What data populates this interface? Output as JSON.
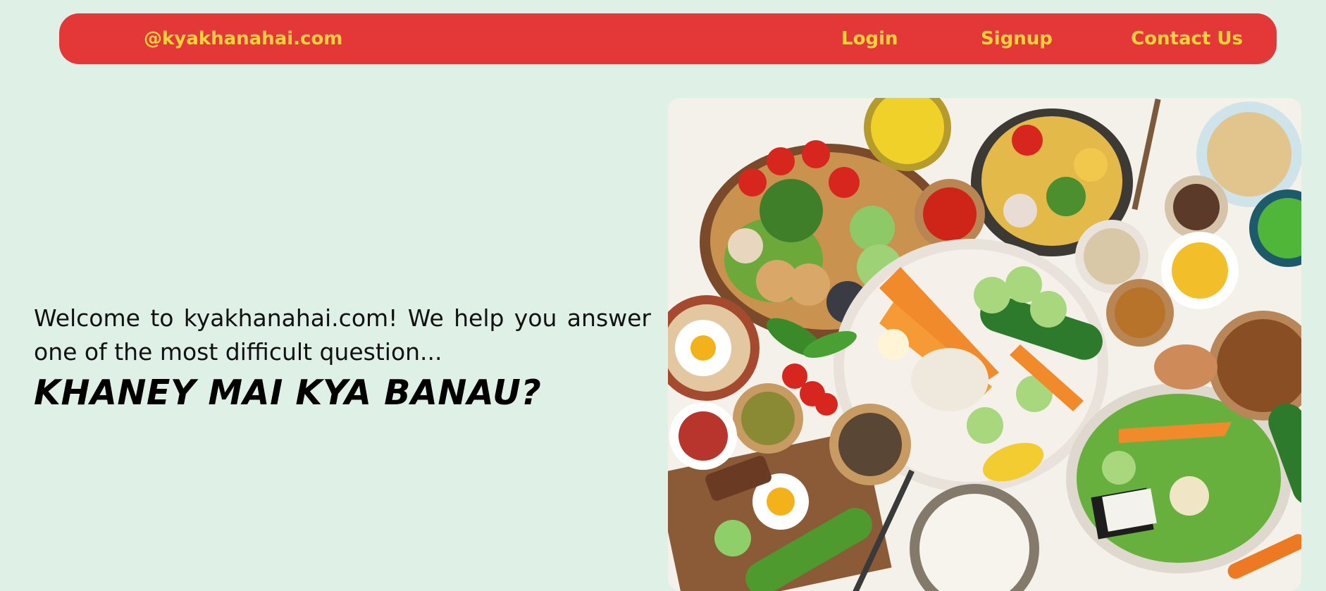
{
  "navbar": {
    "brand": "@kyakhanahai.com",
    "links": [
      {
        "label": "Login"
      },
      {
        "label": "Signup"
      },
      {
        "label": "Contact Us"
      }
    ]
  },
  "intro": {
    "welcome": "Welcome to kyakhanahai.com! We help you answer one of the most difficult question...",
    "tagline": "KHANEY MAI KYA BANAU?"
  },
  "colors": {
    "background": "#dff0e6",
    "navbar": "#e43838",
    "nav_text": "#ffd23d"
  },
  "hero_image": {
    "icon": "food-spread-illustration"
  }
}
